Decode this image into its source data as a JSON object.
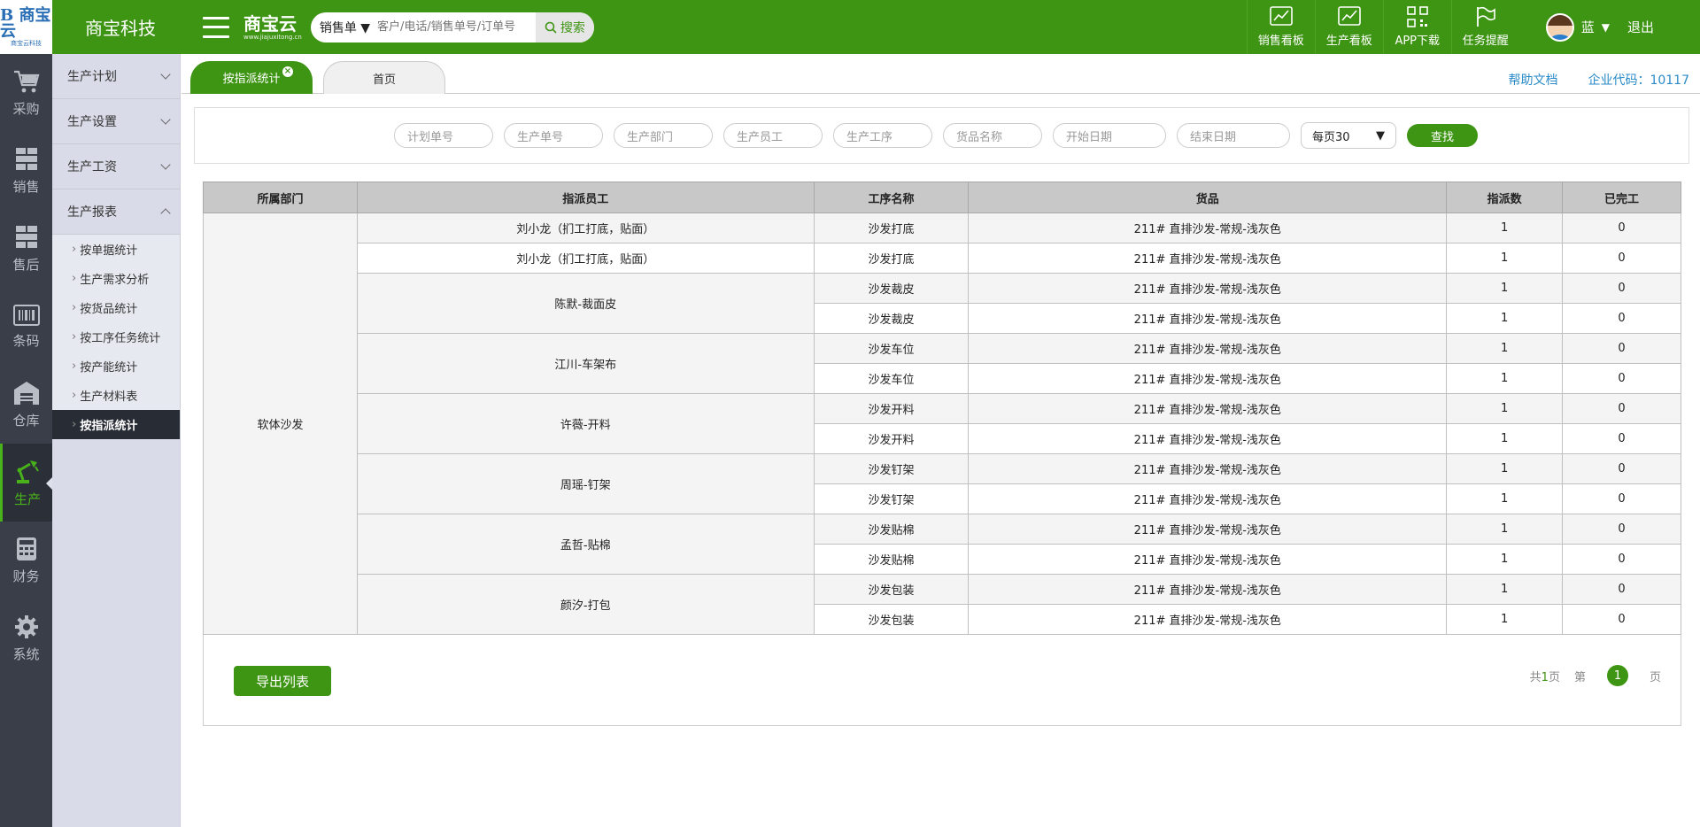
{
  "app": {
    "logo_text": "B 商宝云",
    "logo_small": "商宝云科技",
    "company": "商宝科技",
    "brand_name": "商宝云",
    "brand_url": "www.jiajuxitong.cn"
  },
  "search": {
    "type": "销售单",
    "placeholder": "客户/电话/销售单号/订单号",
    "button": "搜索"
  },
  "top_tools": [
    {
      "label": "销售看板",
      "icon": "chart-trend-icon"
    },
    {
      "label": "生产看板",
      "icon": "chart-trend-icon"
    },
    {
      "label": "APP下载",
      "icon": "qrcode-icon"
    },
    {
      "label": "任务提醒",
      "icon": "flag-icon"
    }
  ],
  "user": {
    "name": "蓝",
    "logout": "退出"
  },
  "icon_nav": [
    {
      "label": "采购",
      "icon": "cart-icon"
    },
    {
      "label": "销售",
      "icon": "boxes-icon"
    },
    {
      "label": "售后",
      "icon": "boxes-icon"
    },
    {
      "label": "条码",
      "icon": "barcode-icon"
    },
    {
      "label": "仓库",
      "icon": "warehouse-icon"
    },
    {
      "label": "生产",
      "icon": "robot-arm-icon",
      "active": true
    },
    {
      "label": "财务",
      "icon": "calculator-icon"
    },
    {
      "label": "系统",
      "icon": "gear-icon"
    }
  ],
  "sub_nav": {
    "heads": [
      "生产计划",
      "生产设置",
      "生产工资",
      "生产报表"
    ],
    "items": [
      "按单据统计",
      "生产需求分析",
      "按货品统计",
      "按工序任务统计",
      "按产能统计",
      "生产材料表",
      "按指派统计"
    ],
    "active_item": "按指派统计"
  },
  "tabs": {
    "active": "按指派统计",
    "inactive": "首页",
    "close": "×"
  },
  "links": {
    "help": "帮助文档",
    "company_code": "企业代码：10117"
  },
  "filter": {
    "plan_no": "计划单号",
    "prod_no": "生产单号",
    "dept": "生产部门",
    "staff": "生产员工",
    "process": "生产工序",
    "goods": "货品名称",
    "start": "开始日期",
    "end": "结束日期",
    "per_page": "每页30",
    "search_btn": "查找"
  },
  "table": {
    "headers": [
      "所属部门",
      "指派员工",
      "工序名称",
      "货品",
      "指派数",
      "已完工"
    ],
    "department": "软体沙发",
    "groups": [
      {
        "employee": "刘小龙（扪工打底，贴面）",
        "split": true,
        "rows": [
          {
            "employee": "刘小龙（扪工打底，贴面）",
            "process": "沙发打底",
            "goods": "211# 直排沙发-常规-浅灰色",
            "assigned": "1",
            "done": "0"
          },
          {
            "employee": "刘小龙（扪工打底，贴面）",
            "process": "沙发打底",
            "goods": "211# 直排沙发-常规-浅灰色",
            "assigned": "1",
            "done": "0"
          }
        ]
      },
      {
        "employee": "陈默-裁面皮",
        "rows": [
          {
            "process": "沙发裁皮",
            "goods": "211# 直排沙发-常规-浅灰色",
            "assigned": "1",
            "done": "0"
          },
          {
            "process": "沙发裁皮",
            "goods": "211# 直排沙发-常规-浅灰色",
            "assigned": "1",
            "done": "0"
          }
        ]
      },
      {
        "employee": "江川-车架布",
        "rows": [
          {
            "process": "沙发车位",
            "goods": "211# 直排沙发-常规-浅灰色",
            "assigned": "1",
            "done": "0"
          },
          {
            "process": "沙发车位",
            "goods": "211# 直排沙发-常规-浅灰色",
            "assigned": "1",
            "done": "0"
          }
        ]
      },
      {
        "employee": "许薇-开料",
        "rows": [
          {
            "process": "沙发开料",
            "goods": "211# 直排沙发-常规-浅灰色",
            "assigned": "1",
            "done": "0"
          },
          {
            "process": "沙发开料",
            "goods": "211# 直排沙发-常规-浅灰色",
            "assigned": "1",
            "done": "0"
          }
        ]
      },
      {
        "employee": "周瑶-钉架",
        "rows": [
          {
            "process": "沙发钉架",
            "goods": "211# 直排沙发-常规-浅灰色",
            "assigned": "1",
            "done": "0"
          },
          {
            "process": "沙发钉架",
            "goods": "211# 直排沙发-常规-浅灰色",
            "assigned": "1",
            "done": "0"
          }
        ]
      },
      {
        "employee": "孟哲-贴棉",
        "rows": [
          {
            "process": "沙发贴棉",
            "goods": "211# 直排沙发-常规-浅灰色",
            "assigned": "1",
            "done": "0"
          },
          {
            "process": "沙发贴棉",
            "goods": "211# 直排沙发-常规-浅灰色",
            "assigned": "1",
            "done": "0"
          }
        ]
      },
      {
        "employee": "颜汐-打包",
        "rows": [
          {
            "process": "沙发包装",
            "goods": "211# 直排沙发-常规-浅灰色",
            "assigned": "1",
            "done": "0"
          },
          {
            "process": "沙发包装",
            "goods": "211# 直排沙发-常规-浅灰色",
            "assigned": "1",
            "done": "0"
          }
        ]
      }
    ]
  },
  "footer": {
    "export": "导出列表",
    "total_prefix": "共",
    "total_pages": "1",
    "total_suffix": "页",
    "page_prefix": "第",
    "current_page": "1",
    "page_suffix": "页"
  },
  "colors": {
    "brand_green": "#3e9413",
    "nav_dark": "#3a3e48",
    "link_blue": "#2a8ac8"
  }
}
